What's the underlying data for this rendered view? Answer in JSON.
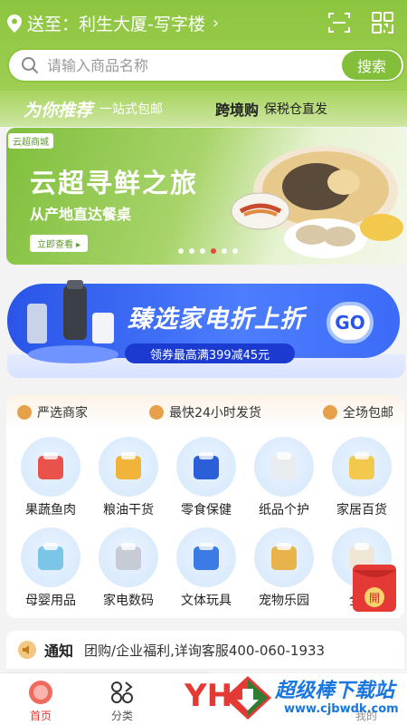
{
  "header": {
    "location_label": "送至：利生大厦-写字楼",
    "search_placeholder": "请输入商品名称",
    "search_button": "搜索"
  },
  "promo": {
    "left_title": "为你推荐",
    "left_sub": "一站式包邮",
    "right_title": "跨境购",
    "right_sub": "保税仓直发"
  },
  "banner": {
    "tag": "云超商城",
    "title": "云超寻鲜之旅",
    "subtitle": "从产地直达餐桌",
    "cta": "立即查看 ▸",
    "dots": 6,
    "active_dot": 4
  },
  "appliance_banner": {
    "title": "臻选家电折上折",
    "coupon": "领券最高满399减45元",
    "go": "GO"
  },
  "features": [
    {
      "label": "严选商家"
    },
    {
      "label": "最快24小时发货"
    },
    {
      "label": "全场包邮"
    }
  ],
  "categories": [
    {
      "label": "果蔬鱼肉",
      "icon": "fruit-veg-meat-icon"
    },
    {
      "label": "粮油干货",
      "icon": "grain-oil-icon"
    },
    {
      "label": "零食保健",
      "icon": "snack-icon"
    },
    {
      "label": "纸品个护",
      "icon": "tissue-icon"
    },
    {
      "label": "家居百货",
      "icon": "home-goods-icon"
    },
    {
      "label": "母婴用品",
      "icon": "baby-icon"
    },
    {
      "label": "家电数码",
      "icon": "electronics-icon"
    },
    {
      "label": "文体玩具",
      "icon": "toy-icon"
    },
    {
      "label": "宠物乐园",
      "icon": "pet-icon"
    },
    {
      "label": "全球",
      "icon": "global-icon"
    }
  ],
  "red_packet": {
    "label": "開"
  },
  "notice": {
    "title": "通知",
    "text": "团购/企业福利,详询客服400-060-1933"
  },
  "nav": {
    "items": [
      {
        "label": "首页"
      },
      {
        "label": "分类"
      },
      {
        "label": ""
      },
      {
        "label": ""
      },
      {
        "label": "我的"
      }
    ]
  },
  "watermark": {
    "brand": "超级棒下载站",
    "url": "www.cjbwdk.com",
    "logo_text": "YH"
  },
  "colors": {
    "brand_green": "#8cc53f",
    "accent_red": "#e53935",
    "appliance_blue": "#2a55e8"
  }
}
